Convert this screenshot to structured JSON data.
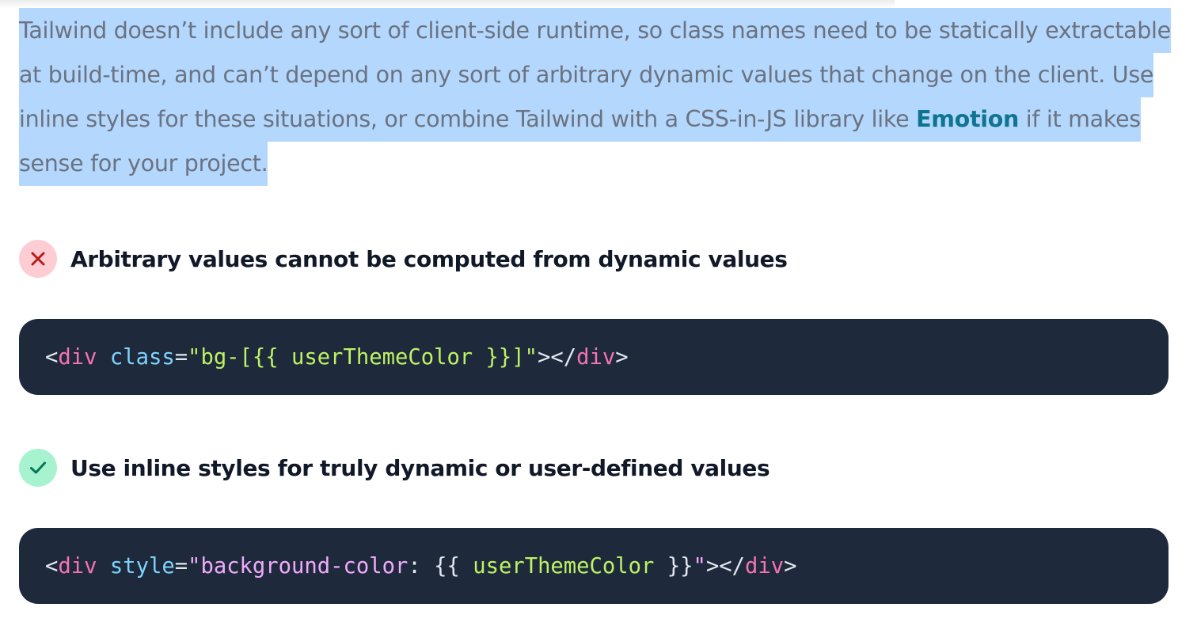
{
  "intro": {
    "text_before_link": "Tailwind doesn’t include any sort of client-side runtime, so class names need to be statically extractable at build-time, and can’t depend on any sort of arbitrary dynamic values that change on the client. Use inline styles for these situations, or combine Tailwind with a CSS-in-JS library like ",
    "link_text": "Emotion",
    "text_after_link": " if it makes sense for your project."
  },
  "bad_example": {
    "icon": "x-icon",
    "heading": "Arbitrary values cannot be computed from dynamic values",
    "code": {
      "open_bracket": "<",
      "tag": "div",
      "space": " ",
      "attr": "class",
      "eq": "=",
      "string": "\"bg-[{{ userThemeColor }}]\"",
      "close_open": "></",
      "close_tag": "div",
      "end": ">"
    }
  },
  "good_example": {
    "icon": "check-icon",
    "heading": "Use inline styles for truly dynamic or user-defined values",
    "code": {
      "open_bracket": "<",
      "tag": "div",
      "space": " ",
      "attr": "style",
      "eq": "=",
      "quote_open": "\"",
      "css_prop": "background-color",
      "colon": ": ",
      "brace_open": "{{",
      "var": " userThemeColor ",
      "brace_close": "}}",
      "quote_close": "\"",
      "close_open": "></",
      "close_tag": "div",
      "end": ">"
    }
  },
  "colors": {
    "selection_highlight": "#b3d7fd",
    "code_background": "#1e293b",
    "bad_badge": "#fecdd3",
    "good_badge": "#a7f3d0",
    "link": "#0e7490"
  }
}
